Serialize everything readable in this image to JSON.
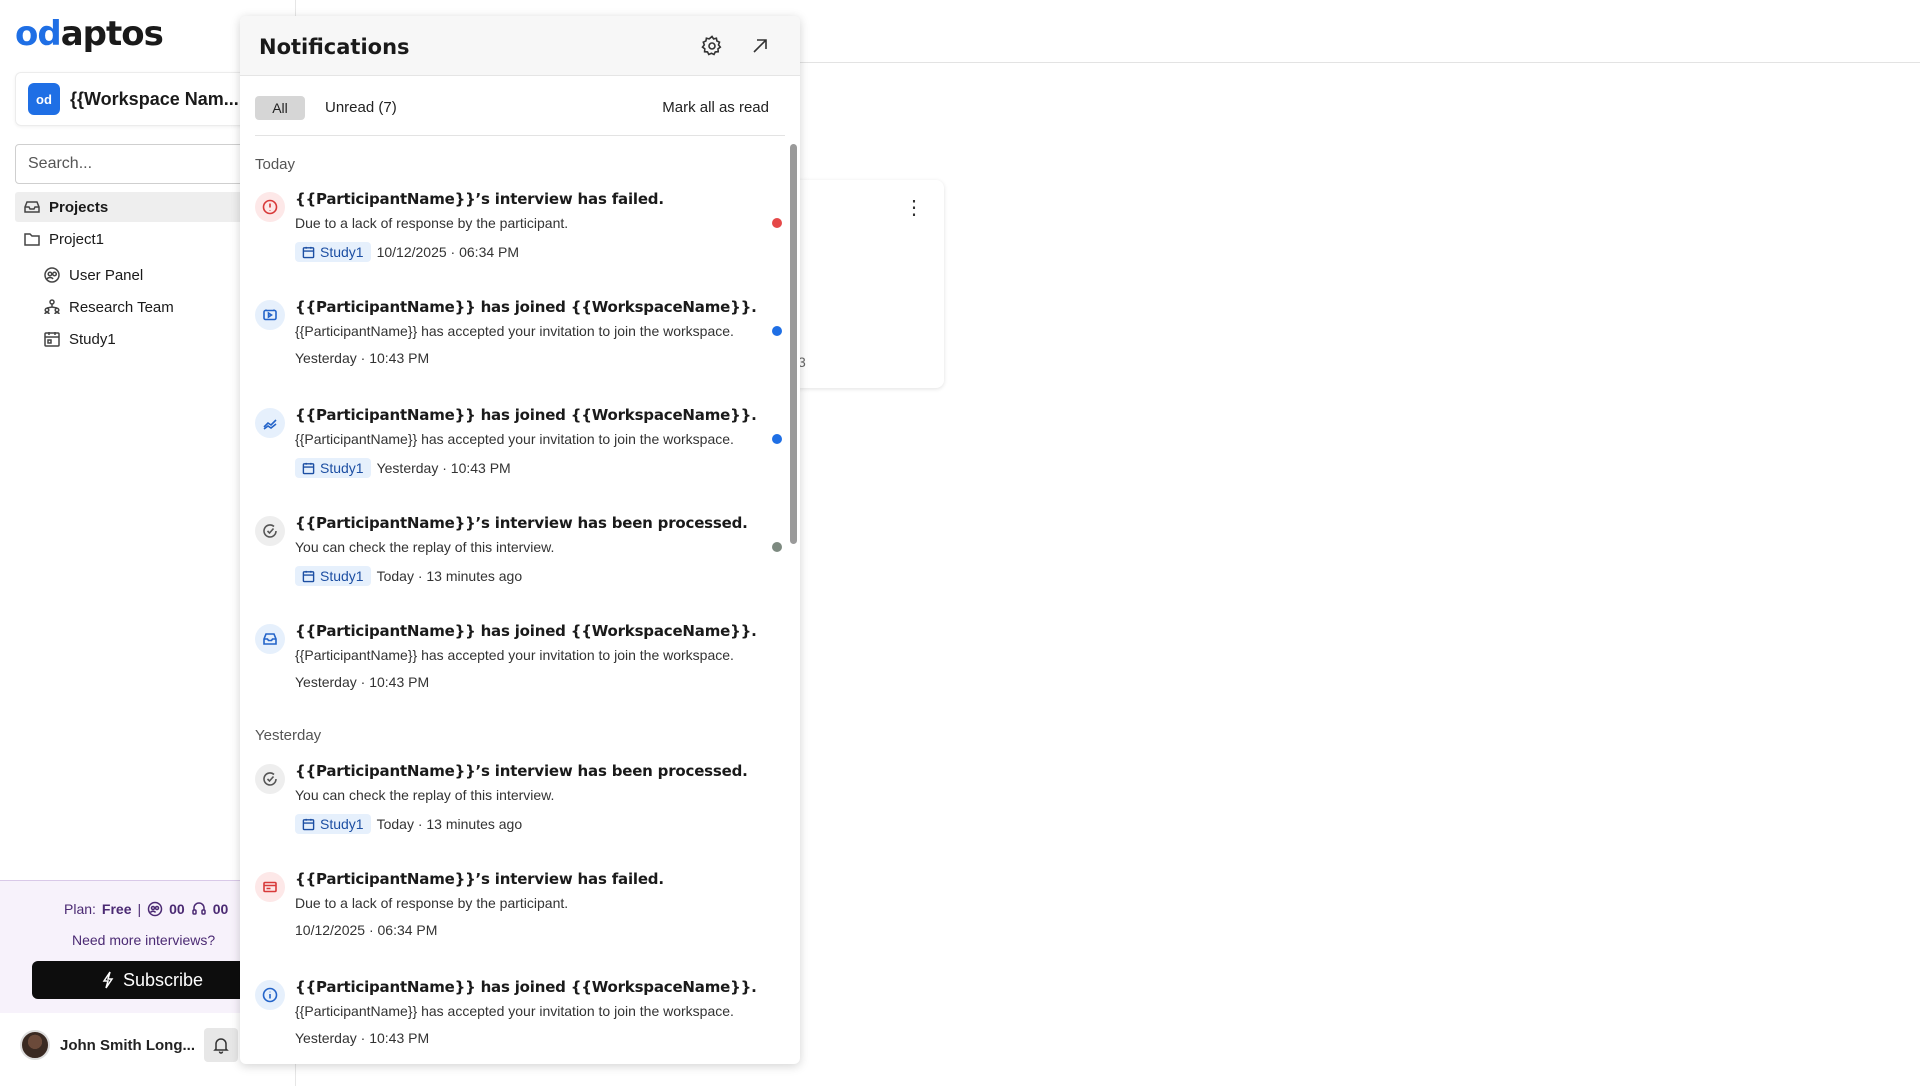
{
  "app": {
    "logo_prefix": "od",
    "logo_rest": "aptos"
  },
  "sidebar": {
    "workspace_icon": "od",
    "workspace_name": "{{Workspace Nam...",
    "search_placeholder": "Search...",
    "nav": {
      "projects": "Projects",
      "project1": "Project1",
      "user_panel": "User Panel",
      "research_team": "Research Team",
      "study1": "Study1"
    },
    "plan": {
      "label": "Plan:",
      "value": "Free",
      "separator": "|",
      "interviews_count": "00",
      "support_count": "00",
      "need_more": "Need more interviews?",
      "subscribe_label": "Subscribe"
    },
    "user": {
      "name": "John Smith Long..."
    }
  },
  "background": {
    "card_fragment": "3"
  },
  "notifications": {
    "title": "Notifications",
    "filters": {
      "all": "All",
      "unread": "Unread (7)",
      "mark_all": "Mark all as read"
    },
    "sections": {
      "today": "Today",
      "yesterday": "Yesterday"
    },
    "items": [
      {
        "icon": "alert-circle-icon",
        "icon_style": "red",
        "title": "{{ParticipantName}}’s interview has failed.",
        "body": "Due to a lack of response by the participant.",
        "chip": "Study1",
        "time": "10/12/2025 · 06:34 PM",
        "unread_color": "#e54848"
      },
      {
        "icon": "video-icon",
        "icon_style": "blue",
        "title": "{{ParticipantName}} has joined {{WorkspaceName}}.",
        "body": "{{ParticipantName}} has accepted your invitation to join the workspace.",
        "chip": "",
        "time": "Yesterday · 10:43 PM",
        "unread_color": "#1f6fe5"
      },
      {
        "icon": "trend-icon",
        "icon_style": "blue",
        "title": "{{ParticipantName}} has joined {{WorkspaceName}}.",
        "body": "{{ParticipantName}} has accepted your invitation to join the workspace.",
        "chip": "Study1",
        "time": "Yesterday · 10:43 PM",
        "unread_color": "#1f6fe5"
      },
      {
        "icon": "check-circle-icon",
        "icon_style": "gray",
        "title": "{{ParticipantName}}’s interview has been processed.",
        "body": "You can check the replay of this interview.",
        "chip": "Study1",
        "time": "Today · 13 minutes ago",
        "unread_color": "#7d8a80"
      },
      {
        "icon": "inbox-icon",
        "icon_style": "blue",
        "title": "{{ParticipantName}} has joined {{WorkspaceName}}.",
        "body": "{{ParticipantName}} has accepted your invitation to join the workspace.",
        "chip": "",
        "time": "Yesterday · 10:43 PM",
        "unread_color": ""
      },
      {
        "icon": "check-circle-icon",
        "icon_style": "gray",
        "title": "{{ParticipantName}}’s interview has been processed.",
        "body": "You can check the replay of this interview.",
        "chip": "Study1",
        "time": "Today · 13 minutes ago",
        "unread_color": ""
      },
      {
        "icon": "card-icon",
        "icon_style": "red",
        "title": "{{ParticipantName}}’s interview has failed.",
        "body": "Due to a lack of response by the participant.",
        "chip": "",
        "time": "10/12/2025 · 06:34 PM",
        "unread_color": ""
      },
      {
        "icon": "info-circle-icon",
        "icon_style": "blue",
        "title": "{{ParticipantName}} has joined {{WorkspaceName}}.",
        "body": "{{ParticipantName}} has accepted your invitation to join the workspace.",
        "chip": "",
        "time": "Yesterday · 10:43 PM",
        "unread_color": ""
      }
    ]
  }
}
